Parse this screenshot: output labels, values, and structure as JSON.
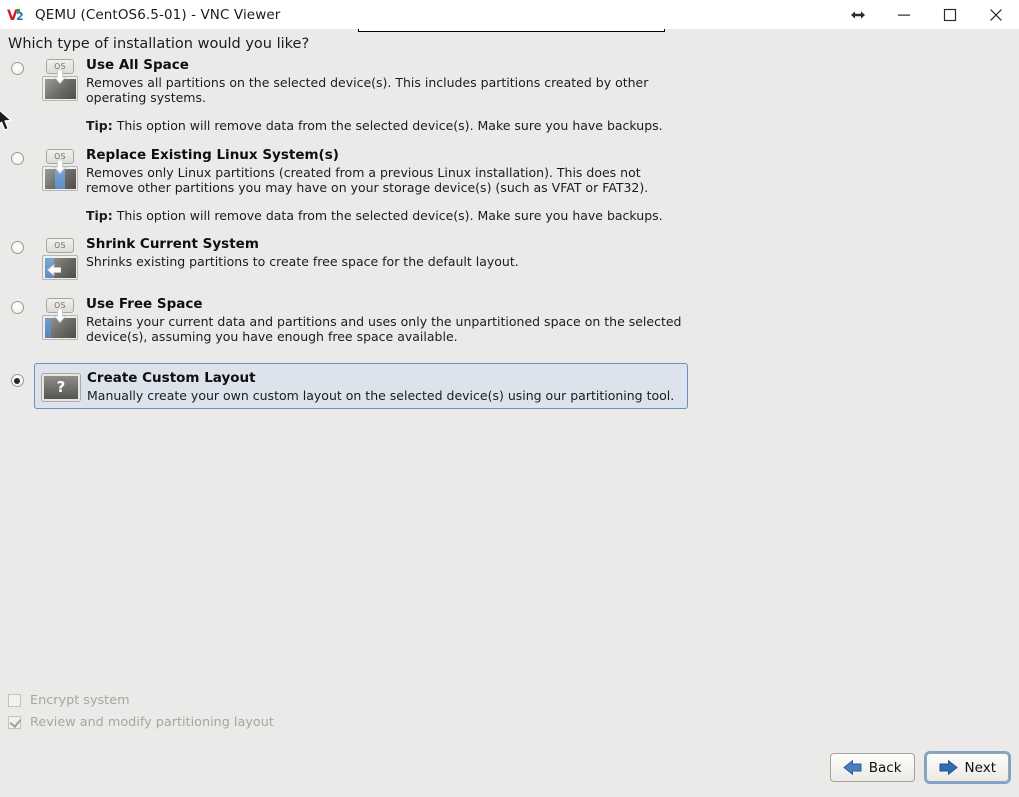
{
  "window": {
    "title": "QEMU (CentOS6.5-01) - VNC Viewer",
    "logo_icon": "vnc-logo-icon",
    "controls": [
      {
        "name": "resize-arrows-icon",
        "label": ""
      },
      {
        "name": "minimize-button",
        "label": ""
      },
      {
        "name": "maximize-button",
        "label": ""
      },
      {
        "name": "close-button",
        "label": ""
      }
    ]
  },
  "installer": {
    "question": "Which type of installation would you like?",
    "options": [
      {
        "id": "use-all-space",
        "title": "Use All Space",
        "desc": "Removes all partitions on the selected device(s).  This includes partitions created by other operating systems.",
        "tip_label": "Tip:",
        "tip": "This option will remove data from the selected device(s).  Make sure you have backups.",
        "selected": false,
        "icon": "disk-erase-all-icon",
        "os_tab": "OS"
      },
      {
        "id": "replace-existing-linux-systems",
        "title": "Replace Existing Linux System(s)",
        "desc": "Removes only Linux partitions (created from a previous Linux installation).  This does not remove other partitions you may have on your storage device(s) (such as VFAT or FAT32).",
        "tip_label": "Tip:",
        "tip": "This option will remove data from the selected device(s).  Make sure you have backups.",
        "selected": false,
        "icon": "disk-replace-linux-icon",
        "os_tab": "OS"
      },
      {
        "id": "shrink-current-system",
        "title": "Shrink Current System",
        "desc": "Shrinks existing partitions to create free space for the default layout.",
        "tip_label": "",
        "tip": "",
        "selected": false,
        "icon": "disk-shrink-icon",
        "os_tab": "OS"
      },
      {
        "id": "use-free-space",
        "title": "Use Free Space",
        "desc": "Retains your current data and partitions and uses only the unpartitioned space on the selected device(s), assuming you have enough free space available.",
        "tip_label": "",
        "tip": "",
        "selected": false,
        "icon": "disk-free-space-icon",
        "os_tab": "OS"
      },
      {
        "id": "create-custom-layout",
        "title": "Create Custom Layout",
        "desc": "Manually create your own custom layout on the selected device(s) using our partitioning tool.",
        "tip_label": "",
        "tip": "",
        "selected": true,
        "icon": "disk-custom-layout-icon",
        "os_tab": "?"
      }
    ],
    "checkboxes": [
      {
        "id": "encrypt-system",
        "label": "Encrypt system",
        "checked": false,
        "disabled": true
      },
      {
        "id": "review-and-modify-partitioning-layout",
        "label": "Review and modify partitioning layout",
        "checked": true,
        "disabled": true
      }
    ],
    "buttons": [
      {
        "id": "back",
        "label": "Back",
        "icon": "arrow-left-icon",
        "focused": false
      },
      {
        "id": "next",
        "label": "Next",
        "icon": "arrow-right-icon",
        "focused": true
      }
    ]
  },
  "colors": {
    "canvas_bg": "#ebeae8",
    "selected_row_bg": "#dde3ec",
    "selected_row_border": "#6a8fc4",
    "focus_ring": "#7ba2d4",
    "disabled_text": "#a6a5a1",
    "accent_blue": "#2d6cb5"
  }
}
